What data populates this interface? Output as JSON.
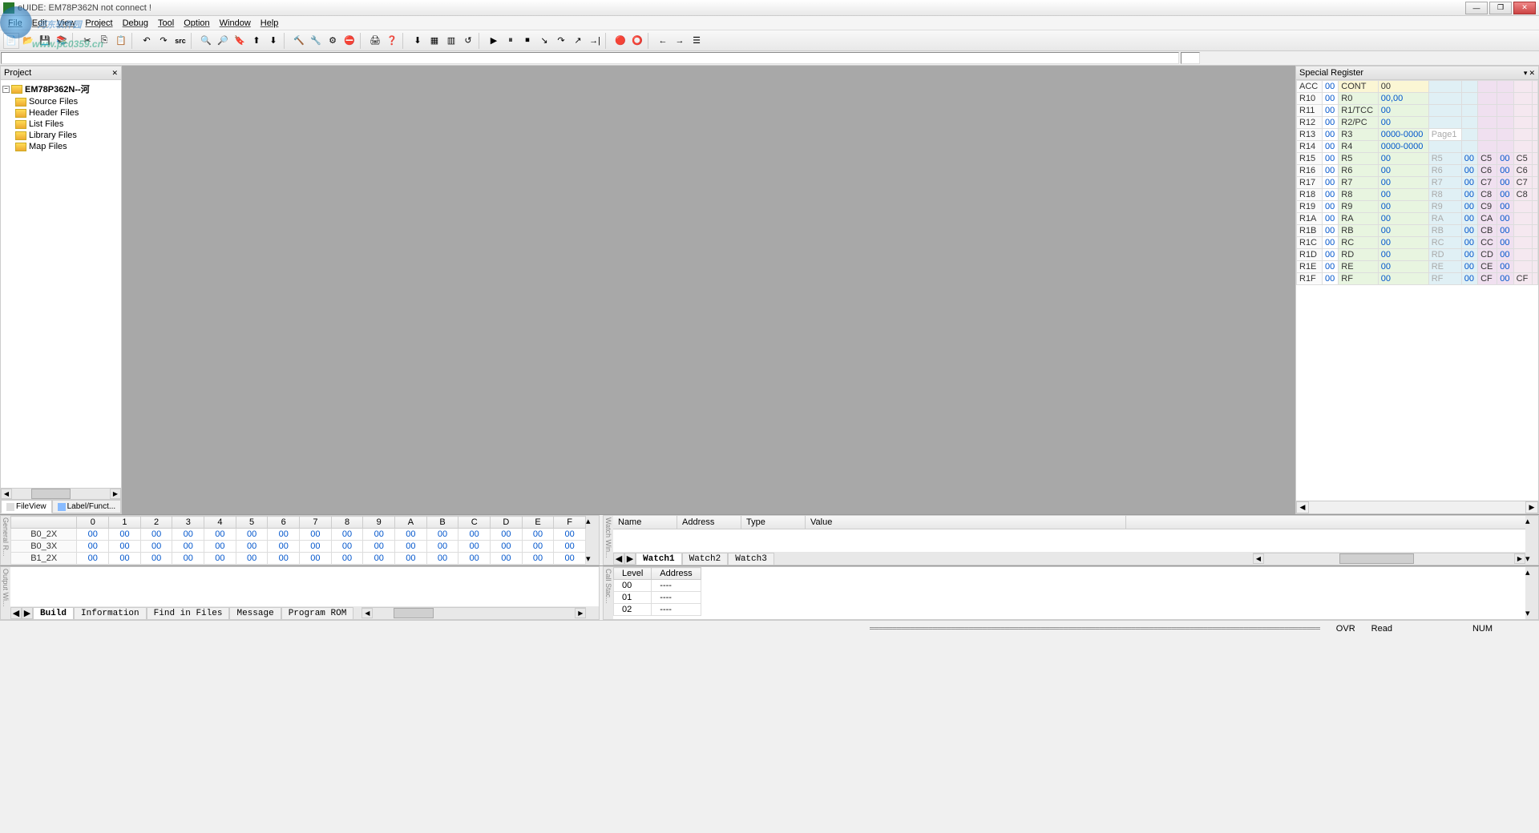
{
  "title": "eUIDE: EM78P362N not connect !",
  "menu": [
    "File",
    "Edit",
    "View",
    "Project",
    "Debug",
    "Tool",
    "Option",
    "Window",
    "Help"
  ],
  "watermark": "河东软件园",
  "watermark_url": "www.pc0359.cn",
  "project": {
    "title": "Project",
    "root": "EM78P362N--河",
    "folders": [
      "Source Files",
      "Header Files",
      "List Files",
      "Library Files",
      "Map Files"
    ],
    "tabs": [
      "FileView",
      "Label/Funct..."
    ]
  },
  "register": {
    "title": "Special Register",
    "rows": [
      [
        "ACC",
        "00",
        "CONT",
        "00",
        "",
        "",
        "",
        "",
        "",
        ""
      ],
      [
        "R10",
        "00",
        "R0",
        "00,00",
        "",
        "",
        "",
        "",
        "",
        ""
      ],
      [
        "R11",
        "00",
        "R1/TCC",
        "00",
        "",
        "",
        "",
        "",
        "",
        ""
      ],
      [
        "R12",
        "00",
        "R2/PC",
        "00",
        "",
        "",
        "",
        "",
        "",
        ""
      ],
      [
        "R13",
        "00",
        "R3",
        "0000-0000",
        "Page1",
        "",
        "",
        "",
        "",
        ""
      ],
      [
        "R14",
        "00",
        "R4",
        "0000-0000",
        "",
        "",
        "",
        "",
        "",
        ""
      ],
      [
        "R15",
        "00",
        "R5",
        "00",
        "R5",
        "00",
        "C5",
        "00",
        "C5",
        ""
      ],
      [
        "R16",
        "00",
        "R6",
        "00",
        "R6",
        "00",
        "C6",
        "00",
        "C6",
        ""
      ],
      [
        "R17",
        "00",
        "R7",
        "00",
        "R7",
        "00",
        "C7",
        "00",
        "C7",
        ""
      ],
      [
        "R18",
        "00",
        "R8",
        "00",
        "R8",
        "00",
        "C8",
        "00",
        "C8",
        ""
      ],
      [
        "R19",
        "00",
        "R9",
        "00",
        "R9",
        "00",
        "C9",
        "00",
        "",
        ""
      ],
      [
        "R1A",
        "00",
        "RA",
        "00",
        "RA",
        "00",
        "CA",
        "00",
        "",
        ""
      ],
      [
        "R1B",
        "00",
        "RB",
        "00",
        "RB",
        "00",
        "CB",
        "00",
        "",
        ""
      ],
      [
        "R1C",
        "00",
        "RC",
        "00",
        "RC",
        "00",
        "CC",
        "00",
        "",
        ""
      ],
      [
        "R1D",
        "00",
        "RD",
        "00",
        "RD",
        "00",
        "CD",
        "00",
        "",
        ""
      ],
      [
        "R1E",
        "00",
        "RE",
        "00",
        "RE",
        "00",
        "CE",
        "00",
        "",
        ""
      ],
      [
        "R1F",
        "00",
        "RF",
        "00",
        "RF",
        "00",
        "CF",
        "00",
        "CF",
        ""
      ]
    ]
  },
  "memory": {
    "cols": [
      "0",
      "1",
      "2",
      "3",
      "4",
      "5",
      "6",
      "7",
      "8",
      "9",
      "A",
      "B",
      "C",
      "D",
      "E",
      "F"
    ],
    "rows": [
      {
        "h": "B0_2X",
        "v": [
          "00",
          "00",
          "00",
          "00",
          "00",
          "00",
          "00",
          "00",
          "00",
          "00",
          "00",
          "00",
          "00",
          "00",
          "00",
          "00"
        ]
      },
      {
        "h": "B0_3X",
        "v": [
          "00",
          "00",
          "00",
          "00",
          "00",
          "00",
          "00",
          "00",
          "00",
          "00",
          "00",
          "00",
          "00",
          "00",
          "00",
          "00"
        ]
      },
      {
        "h": "B1_2X",
        "v": [
          "00",
          "00",
          "00",
          "00",
          "00",
          "00",
          "00",
          "00",
          "00",
          "00",
          "00",
          "00",
          "00",
          "00",
          "00",
          "00"
        ]
      }
    ]
  },
  "watch": {
    "cols": [
      "Name",
      "Address",
      "Type",
      "Value"
    ],
    "tabs": [
      "Watch1",
      "Watch2",
      "Watch3"
    ]
  },
  "output": {
    "tabs": [
      "Build",
      "Information",
      "Find in Files",
      "Message",
      "Program ROM"
    ]
  },
  "stack": {
    "cols": [
      "Level",
      "Address"
    ],
    "rows": [
      [
        "00",
        "----"
      ],
      [
        "01",
        "----"
      ],
      [
        "02",
        "----"
      ]
    ]
  },
  "status": {
    "ovr": "OVR",
    "read": "Read",
    "num": "NUM"
  },
  "sidelabels": {
    "general": "General R...",
    "watch": "Watch Win...",
    "output": "Output Wi...",
    "stack": "Call Stac..."
  }
}
